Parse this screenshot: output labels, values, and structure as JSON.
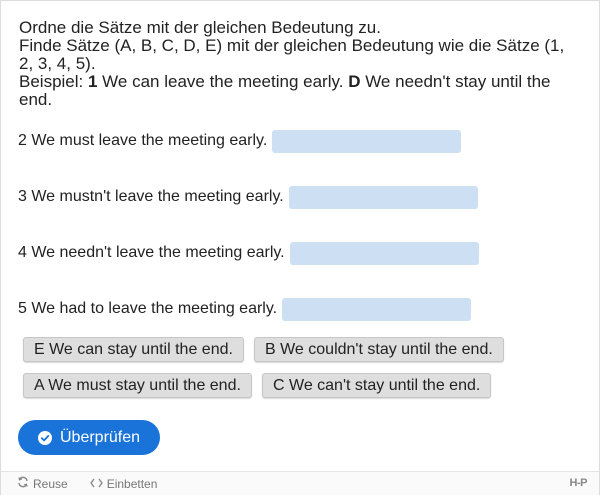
{
  "task": {
    "title": "Ordne die Sätze mit der gleichen Bedeutung zu.",
    "instruction": "Finde Sätze (A, B, C, D, E) mit der gleichen Bedeutung wie die Sätze (1, 2, 3, 4, 5).",
    "example_prefix": "Beispiel: ",
    "example_number": "1",
    "example_sentence": " We can leave the meeting early. ",
    "example_letter": "D",
    "example_answer": " We needn't stay until the end."
  },
  "sentences": [
    {
      "text": "2 We must leave the meeting early."
    },
    {
      "text": "3 We mustn't leave the meeting early."
    },
    {
      "text": "4 We needn't leave the meeting early."
    },
    {
      "text": "5 We had to leave the meeting early."
    }
  ],
  "options": [
    {
      "text": "E We can stay until the end."
    },
    {
      "text": "B We couldn't stay until the end."
    },
    {
      "text": "A We must stay until the end."
    },
    {
      "text": "C We can't stay until the end."
    }
  ],
  "check_button": {
    "label": "Überprüfen",
    "icon": "check-circle-icon",
    "color": "#1a73d9"
  },
  "footer": {
    "reuse_label": "Reuse",
    "embed_label": "Einbetten",
    "logo": "H-P"
  },
  "colors": {
    "drop_zone": "#cddff3",
    "drag_item": "#dedede"
  }
}
